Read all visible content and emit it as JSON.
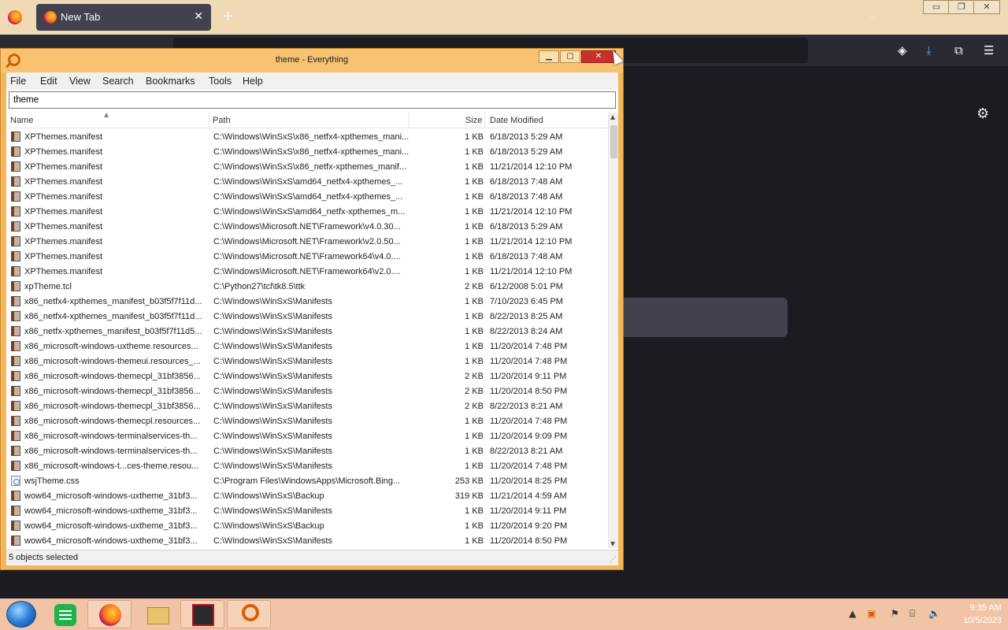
{
  "firefox": {
    "tab_title": "New Tab",
    "tab_close": "✕",
    "new_tab": "+",
    "list_tabs": "⌵",
    "win_min": "▭",
    "win_max": "❐",
    "win_close": "✕",
    "icons": [
      "pocket-icon",
      "downloads-icon",
      "extensions-icon",
      "menu-icon",
      "settings-icon"
    ]
  },
  "everything": {
    "title": "theme - Everything",
    "ctl_min": "▁",
    "ctl_max": "▢",
    "ctl_close": "✕",
    "menu": [
      "File",
      "Edit",
      "View",
      "Search",
      "Bookmarks",
      "Tools",
      "Help"
    ],
    "search_value": "theme",
    "columns": {
      "name": "Name",
      "path": "Path",
      "size": "Size",
      "date": "Date Modified"
    },
    "rows": [
      {
        "name": "XPThemes.manifest",
        "path": "C:\\Windows\\WinSxS\\x86_netfx4-xpthemes_mani...",
        "size": "1 KB",
        "date": "6/18/2013 5:29 AM",
        "icon": "manifest"
      },
      {
        "name": "XPThemes.manifest",
        "path": "C:\\Windows\\WinSxS\\x86_netfx4-xpthemes_mani...",
        "size": "1 KB",
        "date": "6/18/2013 5:29 AM",
        "icon": "manifest"
      },
      {
        "name": "XPThemes.manifest",
        "path": "C:\\Windows\\WinSxS\\x86_netfx-xpthemes_manif...",
        "size": "1 KB",
        "date": "11/21/2014 12:10 PM",
        "icon": "manifest"
      },
      {
        "name": "XPThemes.manifest",
        "path": "C:\\Windows\\WinSxS\\amd64_netfx4-xpthemes_...",
        "size": "1 KB",
        "date": "6/18/2013 7:48 AM",
        "icon": "manifest"
      },
      {
        "name": "XPThemes.manifest",
        "path": "C:\\Windows\\WinSxS\\amd64_netfx4-xpthemes_...",
        "size": "1 KB",
        "date": "6/18/2013 7:48 AM",
        "icon": "manifest"
      },
      {
        "name": "XPThemes.manifest",
        "path": "C:\\Windows\\WinSxS\\amd64_netfx-xpthemes_m...",
        "size": "1 KB",
        "date": "11/21/2014 12:10 PM",
        "icon": "manifest"
      },
      {
        "name": "XPThemes.manifest",
        "path": "C:\\Windows\\Microsoft.NET\\Framework\\v4.0.30...",
        "size": "1 KB",
        "date": "6/18/2013 5:29 AM",
        "icon": "manifest"
      },
      {
        "name": "XPThemes.manifest",
        "path": "C:\\Windows\\Microsoft.NET\\Framework\\v2.0.50...",
        "size": "1 KB",
        "date": "11/21/2014 12:10 PM",
        "icon": "manifest"
      },
      {
        "name": "XPThemes.manifest",
        "path": "C:\\Windows\\Microsoft.NET\\Framework64\\v4.0....",
        "size": "1 KB",
        "date": "6/18/2013 7:48 AM",
        "icon": "manifest"
      },
      {
        "name": "XPThemes.manifest",
        "path": "C:\\Windows\\Microsoft.NET\\Framework64\\v2.0....",
        "size": "1 KB",
        "date": "11/21/2014 12:10 PM",
        "icon": "manifest"
      },
      {
        "name": "xpTheme.tcl",
        "path": "C:\\Python27\\tcl\\tk8.5\\ttk",
        "size": "2 KB",
        "date": "6/12/2008 5:01 PM",
        "icon": "manifest"
      },
      {
        "name": "x86_netfx4-xpthemes_manifest_b03f5f7f11d...",
        "path": "C:\\Windows\\WinSxS\\Manifests",
        "size": "1 KB",
        "date": "7/10/2023 6:45 PM",
        "icon": "manifest"
      },
      {
        "name": "x86_netfx4-xpthemes_manifest_b03f5f7f11d...",
        "path": "C:\\Windows\\WinSxS\\Manifests",
        "size": "1 KB",
        "date": "8/22/2013 8:25 AM",
        "icon": "manifest"
      },
      {
        "name": "x86_netfx-xpthemes_manifest_b03f5f7f11d5...",
        "path": "C:\\Windows\\WinSxS\\Manifests",
        "size": "1 KB",
        "date": "8/22/2013 8:24 AM",
        "icon": "manifest"
      },
      {
        "name": "x86_microsoft-windows-uxtheme.resources...",
        "path": "C:\\Windows\\WinSxS\\Manifests",
        "size": "1 KB",
        "date": "11/20/2014 7:48 PM",
        "icon": "manifest"
      },
      {
        "name": "x86_microsoft-windows-themeui.resources_...",
        "path": "C:\\Windows\\WinSxS\\Manifests",
        "size": "1 KB",
        "date": "11/20/2014 7:48 PM",
        "icon": "manifest"
      },
      {
        "name": "x86_microsoft-windows-themecpl_31bf3856...",
        "path": "C:\\Windows\\WinSxS\\Manifests",
        "size": "2 KB",
        "date": "11/20/2014 9:11 PM",
        "icon": "manifest"
      },
      {
        "name": "x86_microsoft-windows-themecpl_31bf3856...",
        "path": "C:\\Windows\\WinSxS\\Manifests",
        "size": "2 KB",
        "date": "11/20/2014 8:50 PM",
        "icon": "manifest"
      },
      {
        "name": "x86_microsoft-windows-themecpl_31bf3856...",
        "path": "C:\\Windows\\WinSxS\\Manifests",
        "size": "2 KB",
        "date": "8/22/2013 8:21 AM",
        "icon": "manifest"
      },
      {
        "name": "x86_microsoft-windows-themecpl.resources...",
        "path": "C:\\Windows\\WinSxS\\Manifests",
        "size": "1 KB",
        "date": "11/20/2014 7:48 PM",
        "icon": "manifest"
      },
      {
        "name": "x86_microsoft-windows-terminalservices-th...",
        "path": "C:\\Windows\\WinSxS\\Manifests",
        "size": "1 KB",
        "date": "11/20/2014 9:09 PM",
        "icon": "manifest"
      },
      {
        "name": "x86_microsoft-windows-terminalservices-th...",
        "path": "C:\\Windows\\WinSxS\\Manifests",
        "size": "1 KB",
        "date": "8/22/2013 8:21 AM",
        "icon": "manifest"
      },
      {
        "name": "x86_microsoft-windows-t...ces-theme.resou...",
        "path": "C:\\Windows\\WinSxS\\Manifests",
        "size": "1 KB",
        "date": "11/20/2014 7:48 PM",
        "icon": "manifest"
      },
      {
        "name": "wsjTheme.css",
        "path": "C:\\Program Files\\WindowsApps\\Microsoft.Bing...",
        "size": "253 KB",
        "date": "11/20/2014 8:25 PM",
        "icon": "css"
      },
      {
        "name": "wow64_microsoft-windows-uxtheme_31bf3...",
        "path": "C:\\Windows\\WinSxS\\Backup",
        "size": "319 KB",
        "date": "11/21/2014 4:59 AM",
        "icon": "manifest"
      },
      {
        "name": "wow64_microsoft-windows-uxtheme_31bf3...",
        "path": "C:\\Windows\\WinSxS\\Manifests",
        "size": "1 KB",
        "date": "11/20/2014 9:11 PM",
        "icon": "manifest"
      },
      {
        "name": "wow64_microsoft-windows-uxtheme_31bf3...",
        "path": "C:\\Windows\\WinSxS\\Backup",
        "size": "1 KB",
        "date": "11/20/2014 9:20 PM",
        "icon": "manifest"
      },
      {
        "name": "wow64_microsoft-windows-uxtheme_31bf3...",
        "path": "C:\\Windows\\WinSxS\\Manifests",
        "size": "1 KB",
        "date": "11/20/2014 8:50 PM",
        "icon": "manifest"
      }
    ],
    "status": "5 objects selected"
  },
  "taskbar": {
    "apps": [
      "start-button",
      "notes-app",
      "firefox",
      "file-explorer",
      "media-app",
      "everything-search"
    ],
    "clock_time": "9:35 AM",
    "clock_date": "10/5/2023"
  }
}
